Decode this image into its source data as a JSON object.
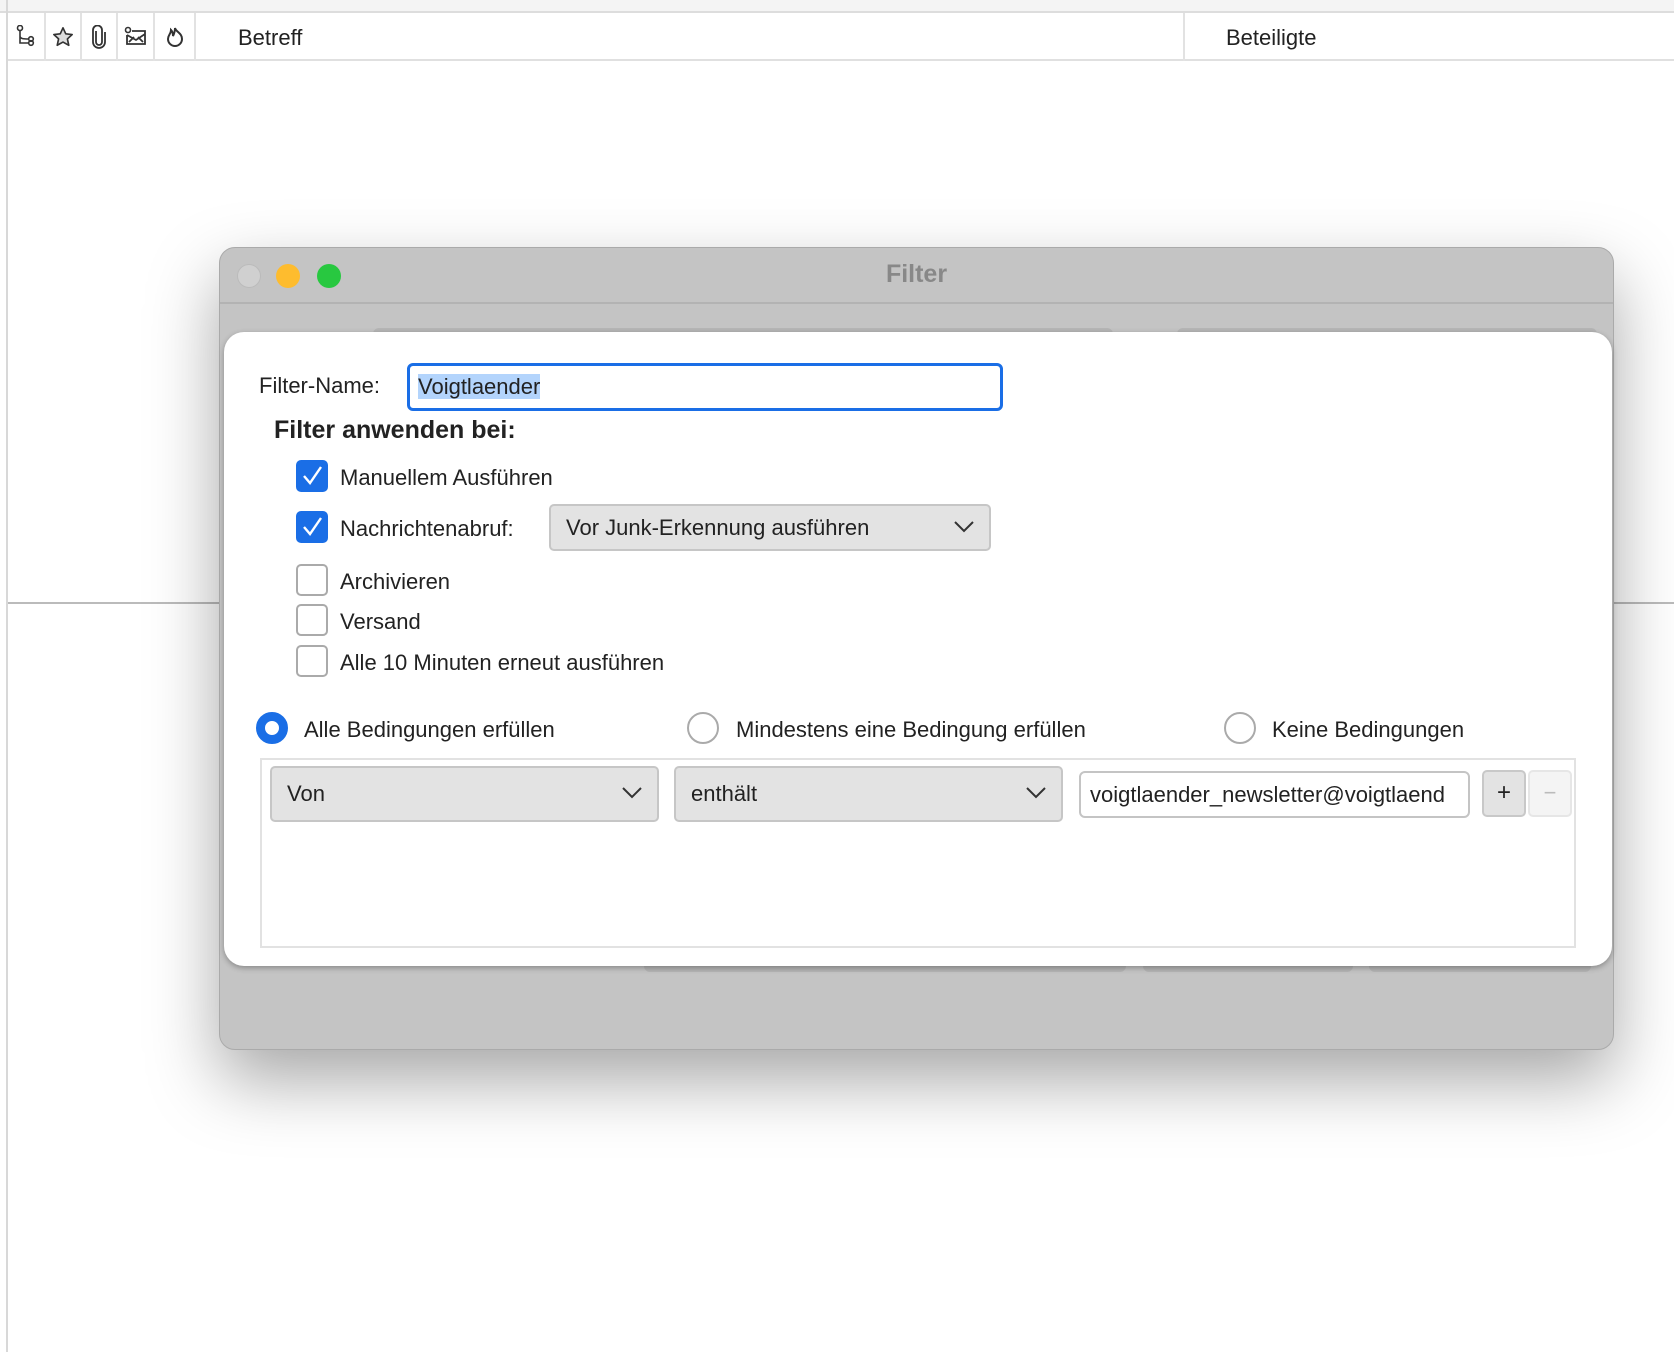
{
  "columns": {
    "thread_icon": "thread-icon",
    "star_icon": "star-icon",
    "attachment_icon": "attachment-icon",
    "read_icon": "read-status-icon",
    "junk_icon": "junk-icon",
    "subject": "Betreff",
    "correspondents": "Beteiligte"
  },
  "window": {
    "title": "Filter"
  },
  "filter": {
    "name_label": "Filter-Name:",
    "name_value": "Voigtlaender",
    "apply_heading": "Filter anwenden bei:",
    "options": [
      {
        "label": "Manuellem Ausführen",
        "checked": true
      },
      {
        "label": "Nachrichtenabruf:",
        "checked": true
      },
      {
        "label": "Archivieren",
        "checked": false
      },
      {
        "label": "Versand",
        "checked": false
      },
      {
        "label": "Alle 10 Minuten erneut ausführen",
        "checked": false
      }
    ],
    "fetch_timing": "Vor Junk-Erkennung ausführen",
    "match": [
      {
        "label": "Alle Bedingungen erfüllen",
        "selected": true
      },
      {
        "label": "Mindestens eine Bedingung erfüllen",
        "selected": false
      },
      {
        "label": "Keine Bedingungen",
        "selected": false
      }
    ],
    "rule": {
      "field": "Von",
      "operator": "enthält",
      "value": "voigtlaender_newsletter@voigtlaend",
      "add": "+",
      "remove": "−"
    }
  },
  "colors": {
    "accent": "#1a6ee6",
    "close": "#d0d0d0",
    "minimize": "#febc2e",
    "zoom": "#28c840"
  }
}
